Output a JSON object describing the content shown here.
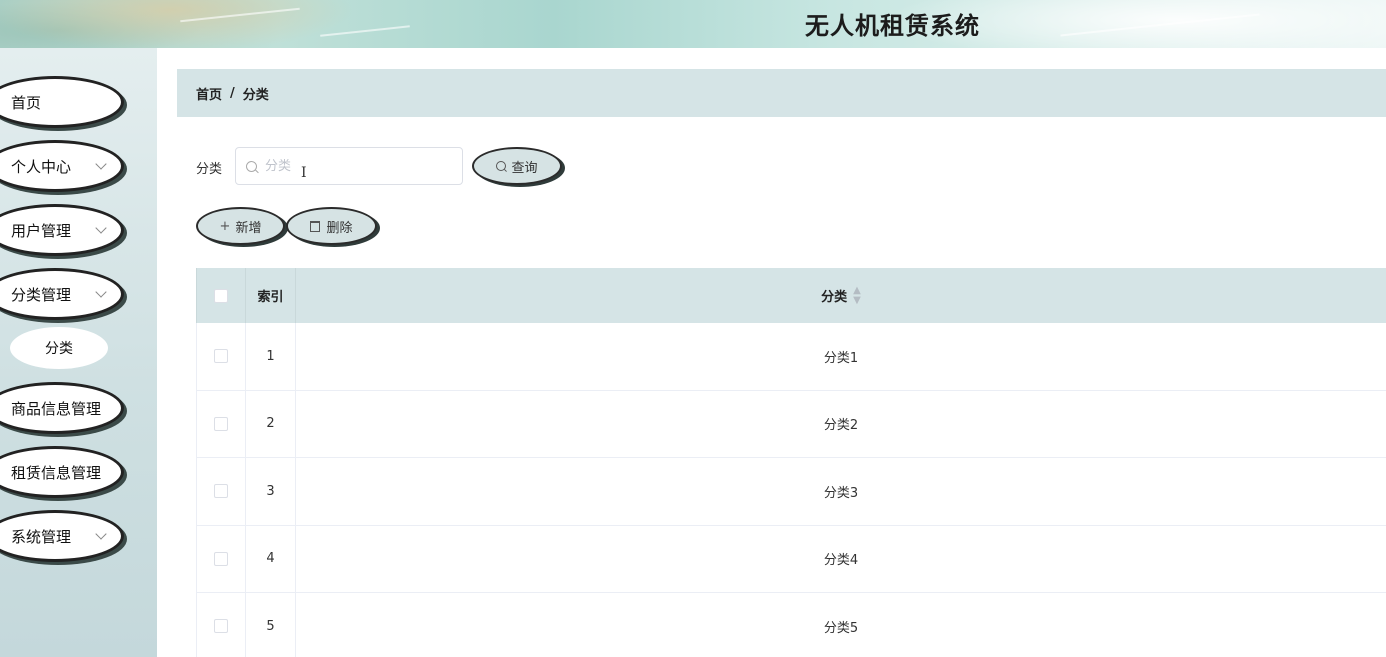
{
  "header": {
    "title": "无人机租赁系统"
  },
  "sidebar": {
    "items": [
      {
        "label": "首页",
        "has_children": false
      },
      {
        "label": "个人中心",
        "has_children": true
      },
      {
        "label": "用户管理",
        "has_children": true
      },
      {
        "label": "分类管理",
        "has_children": true
      },
      {
        "label": "商品信息管理",
        "has_children": false
      },
      {
        "label": "租赁信息管理",
        "has_children": false
      },
      {
        "label": "系统管理",
        "has_children": true
      }
    ],
    "active_sub_item": "分类"
  },
  "breadcrumb": {
    "home": "首页",
    "separator": "/",
    "current": "分类"
  },
  "search": {
    "label": "分类",
    "placeholder": "分类",
    "value": "",
    "button_label": "查询"
  },
  "actions": {
    "add_label": "新增",
    "delete_label": "删除"
  },
  "table": {
    "columns": [
      "索引",
      "分类"
    ],
    "rows": [
      {
        "index": "1",
        "category": "分类1"
      },
      {
        "index": "2",
        "category": "分类2"
      },
      {
        "index": "3",
        "category": "分类3"
      },
      {
        "index": "4",
        "category": "分类4"
      },
      {
        "index": "5",
        "category": "分类5"
      }
    ]
  },
  "colors": {
    "header_bg": "#bfe0d8",
    "sidebar_bg": "#cfe0e2",
    "breadcrumb_bg": "#d5e4e6",
    "button_bg": "#d6e3e4",
    "table_head_bg": "#d5e4e6"
  }
}
